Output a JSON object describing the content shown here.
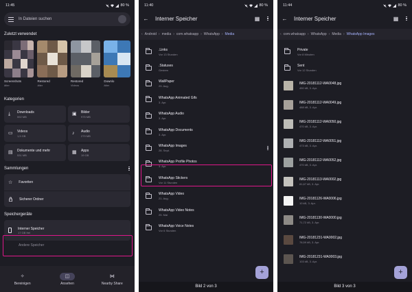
{
  "colors": {
    "background": "#1d1d24",
    "surface": "#2a2932",
    "highlight": "#e0178a",
    "accent": "#a8b4ff",
    "fab": "#a4a2d8"
  },
  "screen1": {
    "status": {
      "time": "11:45",
      "battery": "80 %"
    },
    "search": {
      "placeholder": "In Dateien suchen"
    },
    "recent": {
      "title": "Zuletzt verwendet",
      "items": [
        {
          "name": "Screenshots",
          "sub": "älter"
        },
        {
          "name": "Restored",
          "sub": "älter"
        },
        {
          "name": "Restored",
          "sub": "Videos"
        },
        {
          "name": "Downlo",
          "sub": "älter"
        }
      ]
    },
    "categories": {
      "title": "Kategorien",
      "items": [
        {
          "icon": "download-icon",
          "name": "Downloads",
          "size": "592 MB"
        },
        {
          "icon": "image-icon",
          "name": "Bilder",
          "size": "975 MB"
        },
        {
          "icon": "video-icon",
          "name": "Videos",
          "size": "1,5 GB"
        },
        {
          "icon": "audio-icon",
          "name": "Audio",
          "size": "279 MB"
        },
        {
          "icon": "document-icon",
          "name": "Dokumente und mehr",
          "size": "531 MB"
        },
        {
          "icon": "apps-icon",
          "name": "Apps",
          "size": "19 GB"
        }
      ]
    },
    "collections": {
      "title": "Sammlungen",
      "items": [
        {
          "icon": "star-icon",
          "name": "Favoriten"
        },
        {
          "icon": "lock-icon",
          "name": "Sicherer Ordner"
        }
      ]
    },
    "storage": {
      "title": "Speichergeräte",
      "internal": {
        "name": "Interner Speicher",
        "sub": "17 GB frei"
      },
      "other": "Andere Speicher"
    },
    "nav": [
      {
        "icon": "clean-icon",
        "label": "Bereinigen"
      },
      {
        "icon": "browse-icon",
        "label": "Ansehen"
      },
      {
        "icon": "nearby-share-icon",
        "label": "Nearby Share"
      }
    ]
  },
  "screen2": {
    "status": {
      "time": "11:40",
      "battery": "80 %"
    },
    "title": "Interner Speicher",
    "breadcrumbs": [
      "Android",
      "media",
      "com.whatsapp",
      "WhatsApp",
      "Media"
    ],
    "folders": [
      {
        "name": ".Links",
        "date": "Vor 13 Stunden"
      },
      {
        "name": ".Statuses",
        "date": "Gestern"
      },
      {
        "name": "WallPaper",
        "date": "29. Aug."
      },
      {
        "name": "WhatsApp Animated Gifs",
        "date": "3. Apr."
      },
      {
        "name": "WhatsApp Audio",
        "date": "3. Apr."
      },
      {
        "name": "WhatsApp Documents",
        "date": "3. Apr."
      },
      {
        "name": "WhatsApp Images",
        "date": "28. Sept."
      },
      {
        "name": "WhatsApp Profile Photos",
        "date": "3. Apr."
      },
      {
        "name": "WhatsApp Stickers",
        "date": "Vor 11 Stunden"
      },
      {
        "name": "WhatsApp Video",
        "date": "21. Aug."
      },
      {
        "name": "WhatsApp Video Notes",
        "date": "25. Mai"
      },
      {
        "name": "WhatsApp Voice Notes",
        "date": "Vor 6 Stunden"
      }
    ],
    "pager": "Bild 2 von 3"
  },
  "screen3": {
    "status": {
      "time": "11:44",
      "battery": "80 %"
    },
    "title": "Interner Speicher",
    "breadcrumbs": [
      "com.whatsapp",
      "WhatsApp",
      "Media",
      "WhatsApp Images"
    ],
    "folders": [
      {
        "name": "Private",
        "date": "Vor 8 Minuten"
      },
      {
        "name": "Sent",
        "date": "Vor 12 Stunden"
      }
    ],
    "files": [
      {
        "name": "IMG-20181112-WA0048.jpg",
        "info": "450 kB, 3. Apr.",
        "color": "#b9b4a8"
      },
      {
        "name": "IMG-20181112-WA0049.jpg",
        "info": "488 kB, 3. Apr.",
        "color": "#a7a19a"
      },
      {
        "name": "IMG-20181112-WA0050.jpg",
        "info": "470 kB, 3. Apr.",
        "color": "#bdbcb7"
      },
      {
        "name": "IMG-20181112-WA0051.jpg",
        "info": "473 kB, 3. Apr.",
        "color": "#aeb0b2"
      },
      {
        "name": "IMG-20181112-WA0052.jpg",
        "info": "470 kB, 3. Apr.",
        "color": "#9da1a0"
      },
      {
        "name": "IMG-20181113-WA0002.jpg",
        "info": "81,67 kB, 3. Apr.",
        "color": "#c4c2bd"
      },
      {
        "name": "IMG-20181126-WA0006.jpg",
        "info": "10 kB, 3. Apr.",
        "color": "#f4f4f4"
      },
      {
        "name": "IMG-20181130-WA0000.jpg",
        "info": "71,72 kB, 3. Apr.",
        "color": "#8d8a86"
      },
      {
        "name": "IMG-20181231-WA0002.jpg",
        "info": "78,59 kB, 3. Apr.",
        "color": "#5a4940"
      },
      {
        "name": "IMG-20181231-WA0003.jpg",
        "info": "103 kB, 3. Apr.",
        "color": "#5c5550"
      }
    ],
    "pager": "Bild 3 von 3"
  }
}
